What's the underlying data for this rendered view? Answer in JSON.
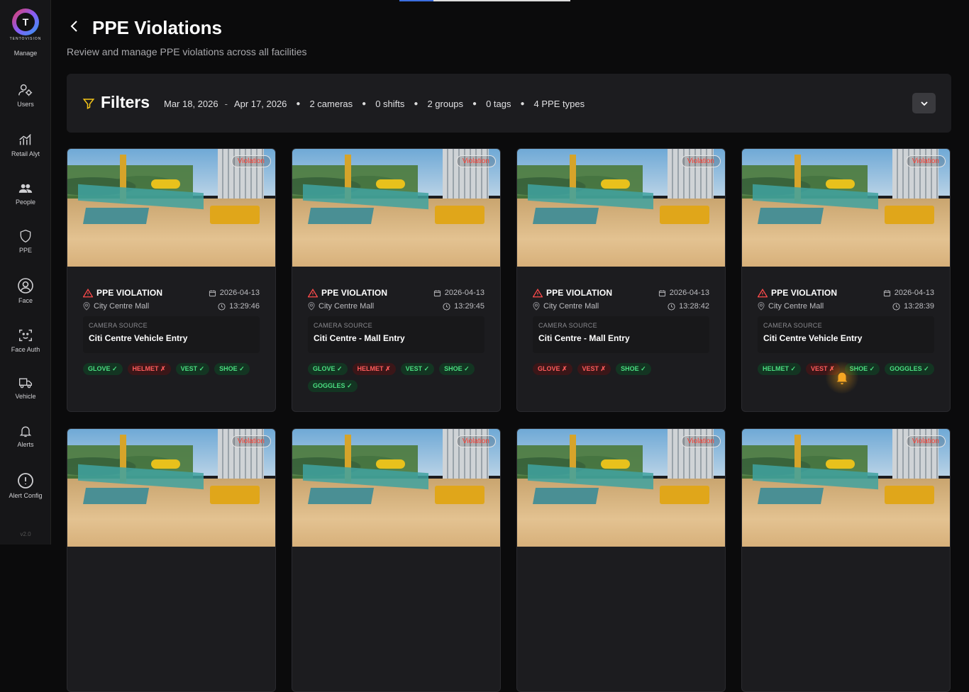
{
  "brand": {
    "logo_letter": "T",
    "logo_text": "TENTOVISION"
  },
  "sidebar": {
    "manage_label": "Manage",
    "items": [
      {
        "label": "Users",
        "icon": "users-gear-icon"
      },
      {
        "label": "Retail Alyt",
        "icon": "chart-icon"
      },
      {
        "label": "People",
        "icon": "people-icon"
      },
      {
        "label": "PPE",
        "icon": "shield-icon"
      },
      {
        "label": "Face",
        "icon": "face-icon"
      },
      {
        "label": "Face Auth",
        "icon": "face-scan-icon"
      },
      {
        "label": "Vehicle",
        "icon": "truck-icon"
      },
      {
        "label": "Alerts",
        "icon": "bell-icon"
      },
      {
        "label": "Alert Config",
        "icon": "alert-circle-icon"
      }
    ],
    "version": "v2.0"
  },
  "header": {
    "title": "PPE Violations",
    "subtitle": "Review and manage PPE violations across all facilities"
  },
  "filters": {
    "title": "Filters",
    "date_from": "Mar 18, 2026",
    "date_sep": "-",
    "date_to": "Apr 17, 2026",
    "cameras": "2 cameras",
    "shifts": "0 shifts",
    "groups": "2 groups",
    "tags": "0 tags",
    "ppe_types": "4 PPE types"
  },
  "cards": [
    {
      "badge": "Violation",
      "type": "PPE VIOLATION",
      "date": "2026-04-13",
      "location": "City Centre Mall",
      "time": "13:29:46",
      "camera_label": "CAMERA SOURCE",
      "camera": "Citi Centre Vehicle Entry",
      "tags": [
        {
          "text": "GLOVE ✓",
          "ok": true
        },
        {
          "text": "HELMET ✗",
          "ok": false
        },
        {
          "text": "VEST ✓",
          "ok": true
        },
        {
          "text": "SHOE ✓",
          "ok": true
        }
      ]
    },
    {
      "badge": "Violation",
      "type": "PPE VIOLATION",
      "date": "2026-04-13",
      "location": "City Centre Mall",
      "time": "13:29:45",
      "camera_label": "CAMERA SOURCE",
      "camera": "Citi Centre - Mall Entry",
      "tags": [
        {
          "text": "GLOVE ✓",
          "ok": true
        },
        {
          "text": "HELMET ✗",
          "ok": false
        },
        {
          "text": "VEST ✓",
          "ok": true
        },
        {
          "text": "SHOE ✓",
          "ok": true
        },
        {
          "text": "GOGGLES ✓",
          "ok": true
        }
      ]
    },
    {
      "badge": "Violation",
      "type": "PPE VIOLATION",
      "date": "2026-04-13",
      "location": "City Centre Mall",
      "time": "13:28:42",
      "camera_label": "CAMERA SOURCE",
      "camera": "Citi Centre - Mall Entry",
      "tags": [
        {
          "text": "GLOVE ✗",
          "ok": false
        },
        {
          "text": "VEST ✗",
          "ok": false
        },
        {
          "text": "SHOE ✓",
          "ok": true
        }
      ]
    },
    {
      "badge": "Violation",
      "type": "PPE VIOLATION",
      "date": "2026-04-13",
      "location": "City Centre Mall",
      "time": "13:28:39",
      "camera_label": "CAMERA SOURCE",
      "camera": "Citi Centre Vehicle Entry",
      "tags": [
        {
          "text": "HELMET ✓",
          "ok": true
        },
        {
          "text": "VEST ✗",
          "ok": false
        },
        {
          "text": "SHOE ✓",
          "ok": true
        },
        {
          "text": "GOGGLES ✓",
          "ok": true
        }
      ]
    },
    {
      "badge": "Violation"
    },
    {
      "badge": "Violation"
    },
    {
      "badge": "Violation"
    },
    {
      "badge": "Violation"
    }
  ],
  "colors": {
    "ok": "#4ade80",
    "bad": "#ff5b5b",
    "accent": "#f5c518"
  }
}
